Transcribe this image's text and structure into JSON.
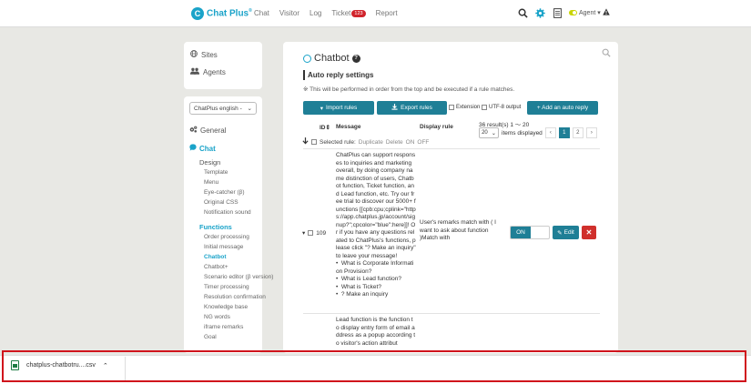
{
  "topbar": {
    "logo_text": "Chat Plus",
    "logo_reg": "®",
    "nav": [
      "Chat",
      "Visitor",
      "Log",
      "Ticket",
      "Report"
    ],
    "ticket_count": "123",
    "agent_label": "Agent",
    "agent_status_color": "#c8d400"
  },
  "sidebar": {
    "sites_label": "Sites",
    "agents_label": "Agents",
    "site_select_value": "ChatPlus english -",
    "general_label": "General",
    "chat_label": "Chat",
    "design_label": "Design",
    "design_items": [
      "Template",
      "Menu",
      "Eye-catcher (β)",
      "Original CSS",
      "Notification sound"
    ],
    "functions_label": "Functions",
    "function_items": [
      "Order processing",
      "Initial message",
      "Chatbot",
      "Chatbot+",
      "Scenario editor (β version)",
      "Timer processing",
      "Resolution confirmation",
      "Knowledge base",
      "NG words",
      "iframe remarks",
      "Goal"
    ]
  },
  "main": {
    "title": "Chatbot",
    "section_title": "Auto reply settings",
    "note": "※ This will be performed in order from the top and be executed if a rule matches.",
    "import_label": "Import rules",
    "export_label": "Export rules",
    "extension_label": "Extension",
    "utf8_label": "UTF-8 output",
    "add_label": "+ Add an auto reply",
    "col_id": "ID",
    "col_message": "Message",
    "col_display_rule": "Display rule",
    "results_text": "36 result(s) 1 〜 20",
    "per_page_value": "20",
    "items_displayed": "items displayed",
    "pages": [
      "‹",
      "1",
      "2",
      "›"
    ],
    "selected_rule_label": "Selected rule:",
    "bulk_actions": [
      "Duplicate",
      "Delete",
      "ON",
      "OFF"
    ],
    "row1": {
      "id": "109",
      "message": "ChatPlus can support responses to inquiries and marketing overall, by doing company name distinction of users, Chatbot function, Ticket function, and Lead function, etc. Try our free trial to discover our 5000+ functions [[cpb:cpu;cplink=\"https://app.chatplus.jp/account/signup?\";cpcolor=\"blue\":here]]! Or if you have any questions related to ChatPlus's functions, please click \"? Make an inquiry\" to leave your message!\n•  What is Corporate Information Provision?\n•  What is Lead function?\n•  What is Ticket?\n•  ? Make an inquiry",
      "display_rule": "User's remarks match with ( I want to ask about function )Match with",
      "toggle": "ON",
      "edit_label": "Edit"
    },
    "row2": {
      "message": "Lead function is the function to display entry form of email address as a popup according to visitor's action attribut"
    }
  },
  "download": {
    "filename": "chatplus-chatbotru....csv",
    "highlight_color": "#d0141c"
  }
}
